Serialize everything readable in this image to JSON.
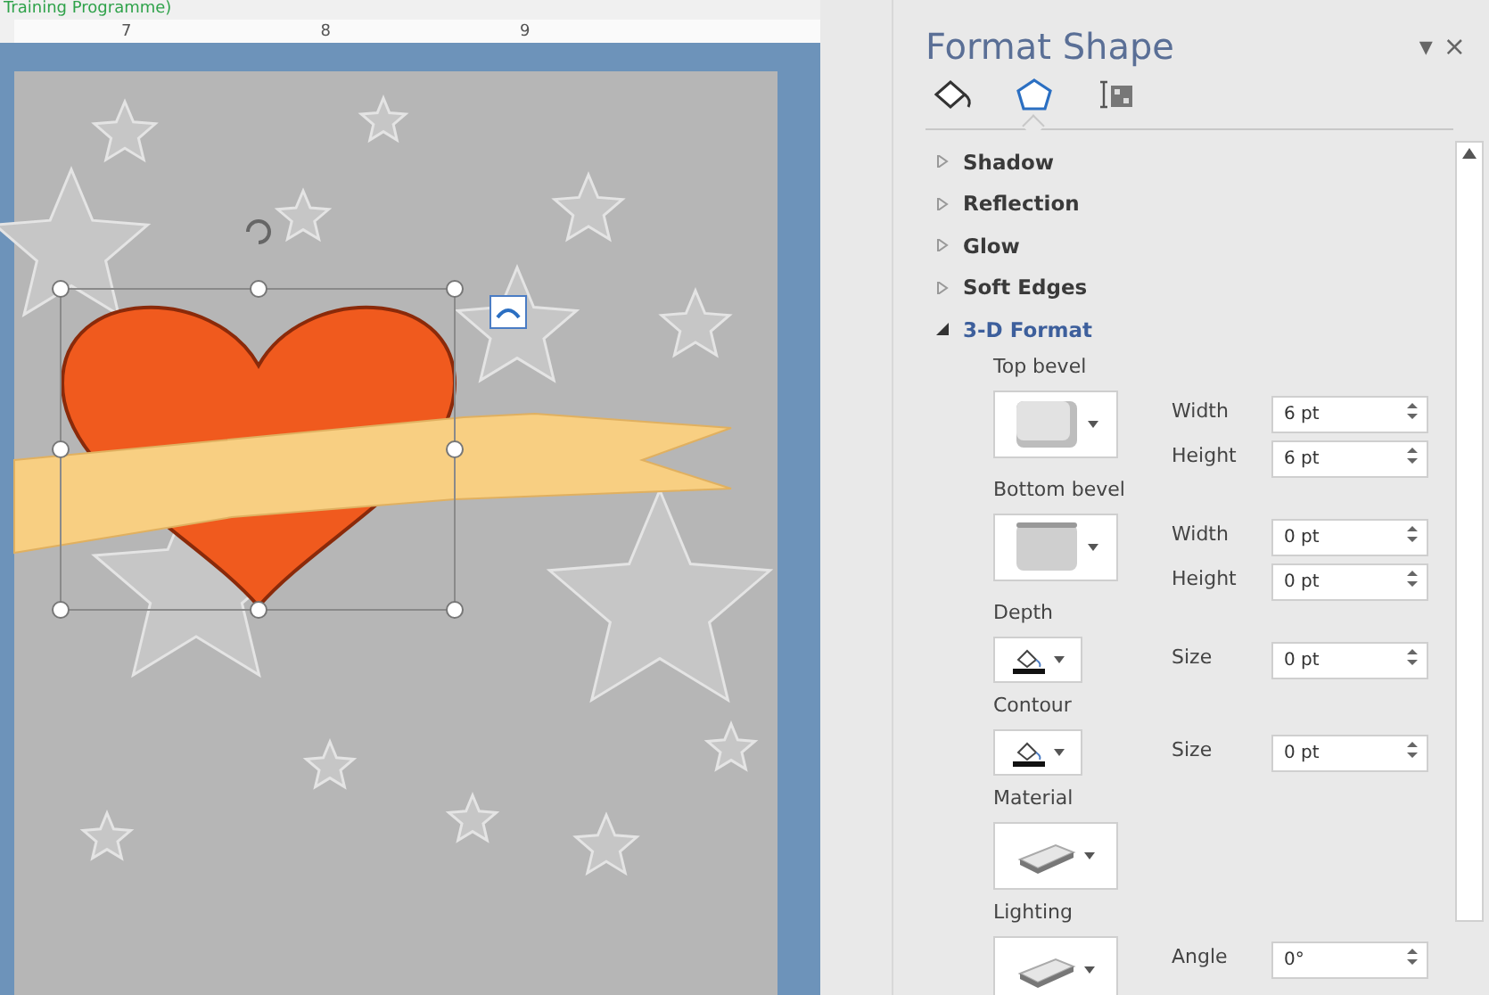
{
  "caption": "Training Programme)",
  "ruler": {
    "marks": [
      "7",
      "8",
      "9"
    ]
  },
  "document": {
    "shape_selected": true
  },
  "pane": {
    "title": "Format Shape",
    "collapse_glyph": "▾",
    "close_glyph": "×",
    "tabs": [
      {
        "selected": false
      },
      {
        "selected": true
      },
      {
        "selected": false
      }
    ],
    "sections": [
      {
        "label": "Shadow",
        "expanded": false
      },
      {
        "label": "Reflection",
        "expanded": false
      },
      {
        "label": "Glow",
        "expanded": false
      },
      {
        "label": "Soft Edges",
        "expanded": false
      },
      {
        "label": "3-D Format",
        "expanded": true
      }
    ],
    "format3d": [
      {
        "kind": "bevel-top",
        "label": "Top bevel",
        "fields": [
          {
            "label": "Width",
            "value": "6 pt"
          },
          {
            "label": "Height",
            "value": "6 pt"
          }
        ]
      },
      {
        "kind": "bevel-bottom",
        "label": "Bottom bevel",
        "fields": [
          {
            "label": "Width",
            "value": "0 pt"
          },
          {
            "label": "Height",
            "value": "0 pt"
          }
        ]
      },
      {
        "kind": "color",
        "label": "Depth",
        "fields": [
          {
            "label": "Size",
            "value": "0 pt"
          }
        ]
      },
      {
        "kind": "color",
        "label": "Contour",
        "fields": [
          {
            "label": "Size",
            "value": "0 pt"
          }
        ]
      },
      {
        "kind": "material",
        "label": "Material"
      },
      {
        "kind": "material",
        "label": "Lighting",
        "fields": [
          {
            "label": "Angle",
            "value": "0°"
          }
        ]
      }
    ]
  }
}
